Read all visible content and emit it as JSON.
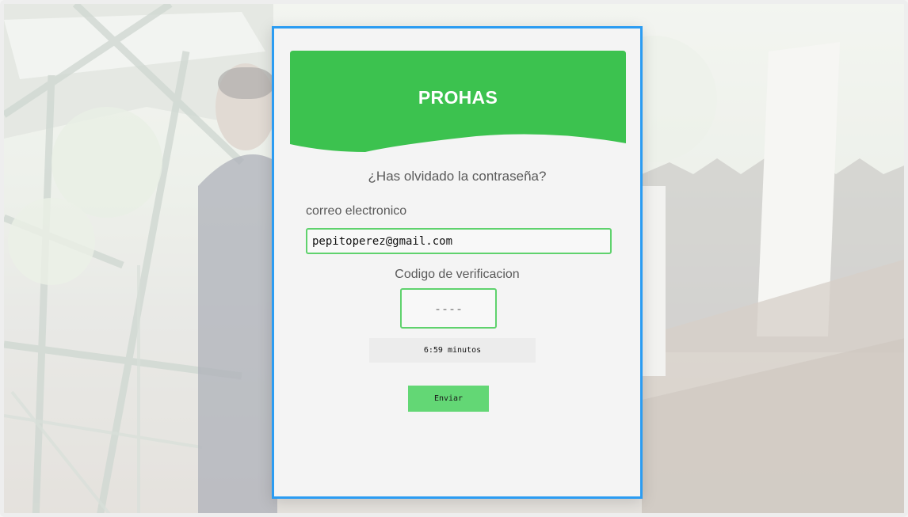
{
  "brand": {
    "name": "PROHAS"
  },
  "form": {
    "heading": "¿Has olvidado la contraseña?",
    "email_label": "correo electronico",
    "email_value": "pepitoperez@gmail.com",
    "code_label": "Codigo de verificacion",
    "code_placeholder": "----",
    "timer_text": "6:59 minutos",
    "send_label": "Enviar"
  },
  "colors": {
    "banner": "#3cc24f",
    "dialog_border": "#2b9cf2",
    "input_border": "#5fd26d",
    "button": "#63d775"
  }
}
